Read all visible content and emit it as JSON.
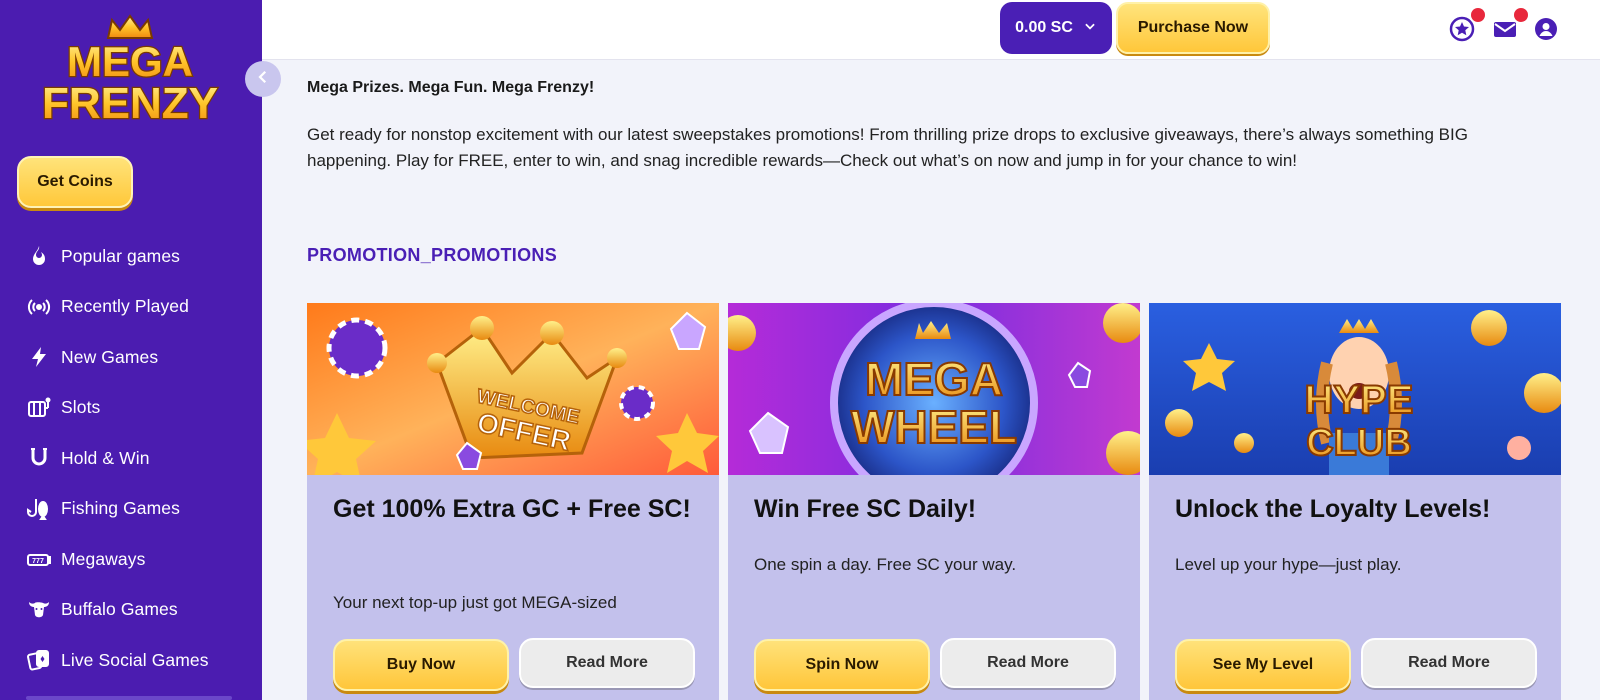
{
  "brand": {
    "logo_line1": "MEGA",
    "logo_line2": "FRENZY"
  },
  "sidebar": {
    "get_coins_label": "Get Coins",
    "items": [
      {
        "label": "Popular games",
        "icon": "flame-icon"
      },
      {
        "label": "Recently Played",
        "icon": "broadcast-icon"
      },
      {
        "label": "New Games",
        "icon": "lightning-icon"
      },
      {
        "label": "Slots",
        "icon": "slot-machine-icon"
      },
      {
        "label": "Hold & Win",
        "icon": "horseshoe-icon"
      },
      {
        "label": "Fishing Games",
        "icon": "fish-hook-icon"
      },
      {
        "label": "Megaways",
        "icon": "megaways-icon"
      },
      {
        "label": "Buffalo Games",
        "icon": "buffalo-icon"
      },
      {
        "label": "Live Social Games",
        "icon": "cards-icon"
      }
    ]
  },
  "topbar": {
    "balance": "0.00 SC",
    "purchase_label": "Purchase Now",
    "icons": [
      "star-badge-icon",
      "mail-icon",
      "user-icon"
    ]
  },
  "main": {
    "headline": "Mega Prizes. Mega Fun. Mega Frenzy!",
    "intro": "Get ready for nonstop excitement with our latest sweepstakes promotions! From thrilling prize drops to exclusive giveaways, there’s always something BIG happening. Play for FREE, enter to win, and snag incredible rewards—Check out what’s on now and jump in for your chance to win!",
    "section_title": "PROMOTION_PROMOTIONS",
    "promotions": [
      {
        "banner_line1": "WELCOME",
        "banner_line2": "OFFER",
        "title": "Get 100% Extra GC + Free SC!",
        "description": "Your next top-up just got MEGA-sized",
        "primary": "Buy Now",
        "secondary": "Read More"
      },
      {
        "banner_line1": "MEGA",
        "banner_line2": "WHEEL",
        "title": "Win Free SC Daily!",
        "description": "One spin a day. Free SC your way.",
        "primary": "Spin Now",
        "secondary": "Read More"
      },
      {
        "banner_line1": "HYPE",
        "banner_line2": "CLUB",
        "title": "Unlock the Loyalty Levels!",
        "description": "Level up your hype—just play.",
        "primary": "See My Level",
        "secondary": "Read More"
      }
    ]
  },
  "colors": {
    "sidebar": "#4b1cb0",
    "accent_purple": "#4a1fb5",
    "gold": "#ffc83a",
    "card_bg": "#c3c1ec",
    "notification": "#e8283c"
  }
}
